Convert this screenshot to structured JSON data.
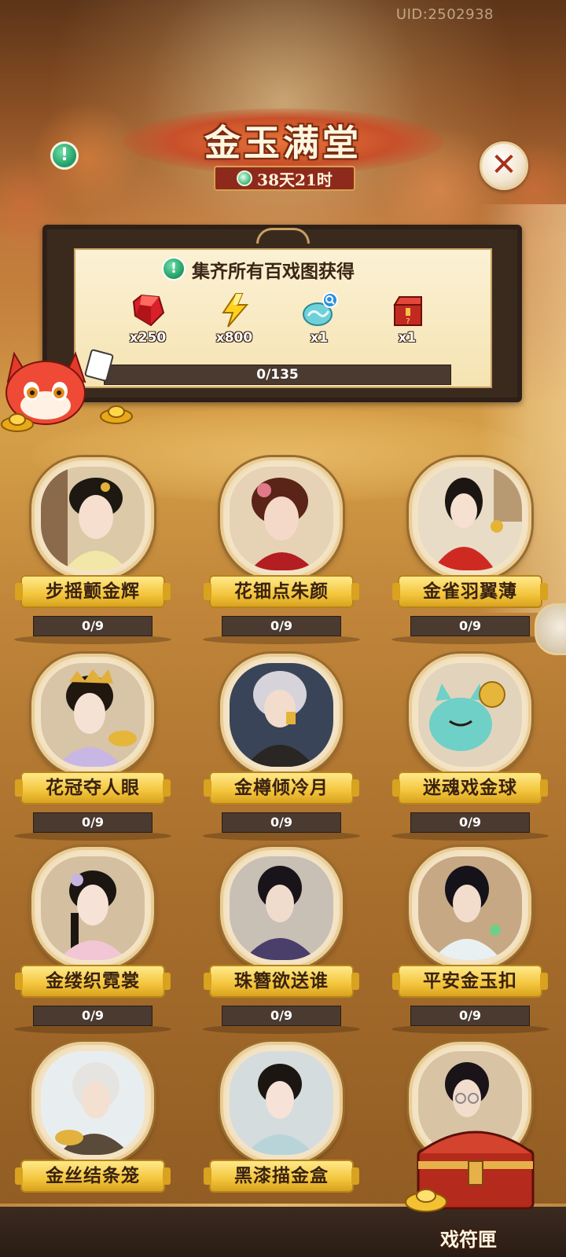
{
  "header": {
    "uid": "UID:2502938",
    "title": "金玉满堂",
    "countdown": "38天21时"
  },
  "reward_panel": {
    "title": "集齐所有百戏图获得",
    "rewards": [
      {
        "icon": "red-gem-icon",
        "count": "x250"
      },
      {
        "icon": "lightning-icon",
        "count": "x800"
      },
      {
        "icon": "jade-cloud-orb-icon",
        "count": "x1"
      },
      {
        "icon": "mystery-chest-icon",
        "count": "x1"
      }
    ],
    "progress_text": "0/135",
    "progress_fraction": 0
  },
  "cards": [
    {
      "name": "步摇颤金辉",
      "progress": "0/9"
    },
    {
      "name": "花钿点朱颜",
      "progress": "0/9"
    },
    {
      "name": "金雀羽翼薄",
      "progress": "0/9"
    },
    {
      "name": "花冠夺人眼",
      "progress": "0/9"
    },
    {
      "name": "金樽倾冷月",
      "progress": "0/9"
    },
    {
      "name": "迷魂戏金球",
      "progress": "0/9"
    },
    {
      "name": "金缕织霓裳",
      "progress": "0/9"
    },
    {
      "name": "珠簪欲送谁",
      "progress": "0/9"
    },
    {
      "name": "平安金玉扣",
      "progress": "0/9"
    },
    {
      "name": "金丝结条笼"
    },
    {
      "name": "黑漆描金盒"
    },
    {
      "name": ""
    }
  ],
  "bottom": {
    "chest_label": "戏符匣"
  },
  "colors": {
    "accent_gold": "#f3c53c",
    "progress_bg": "#4a3a30",
    "title_red": "#8e2a1c"
  }
}
